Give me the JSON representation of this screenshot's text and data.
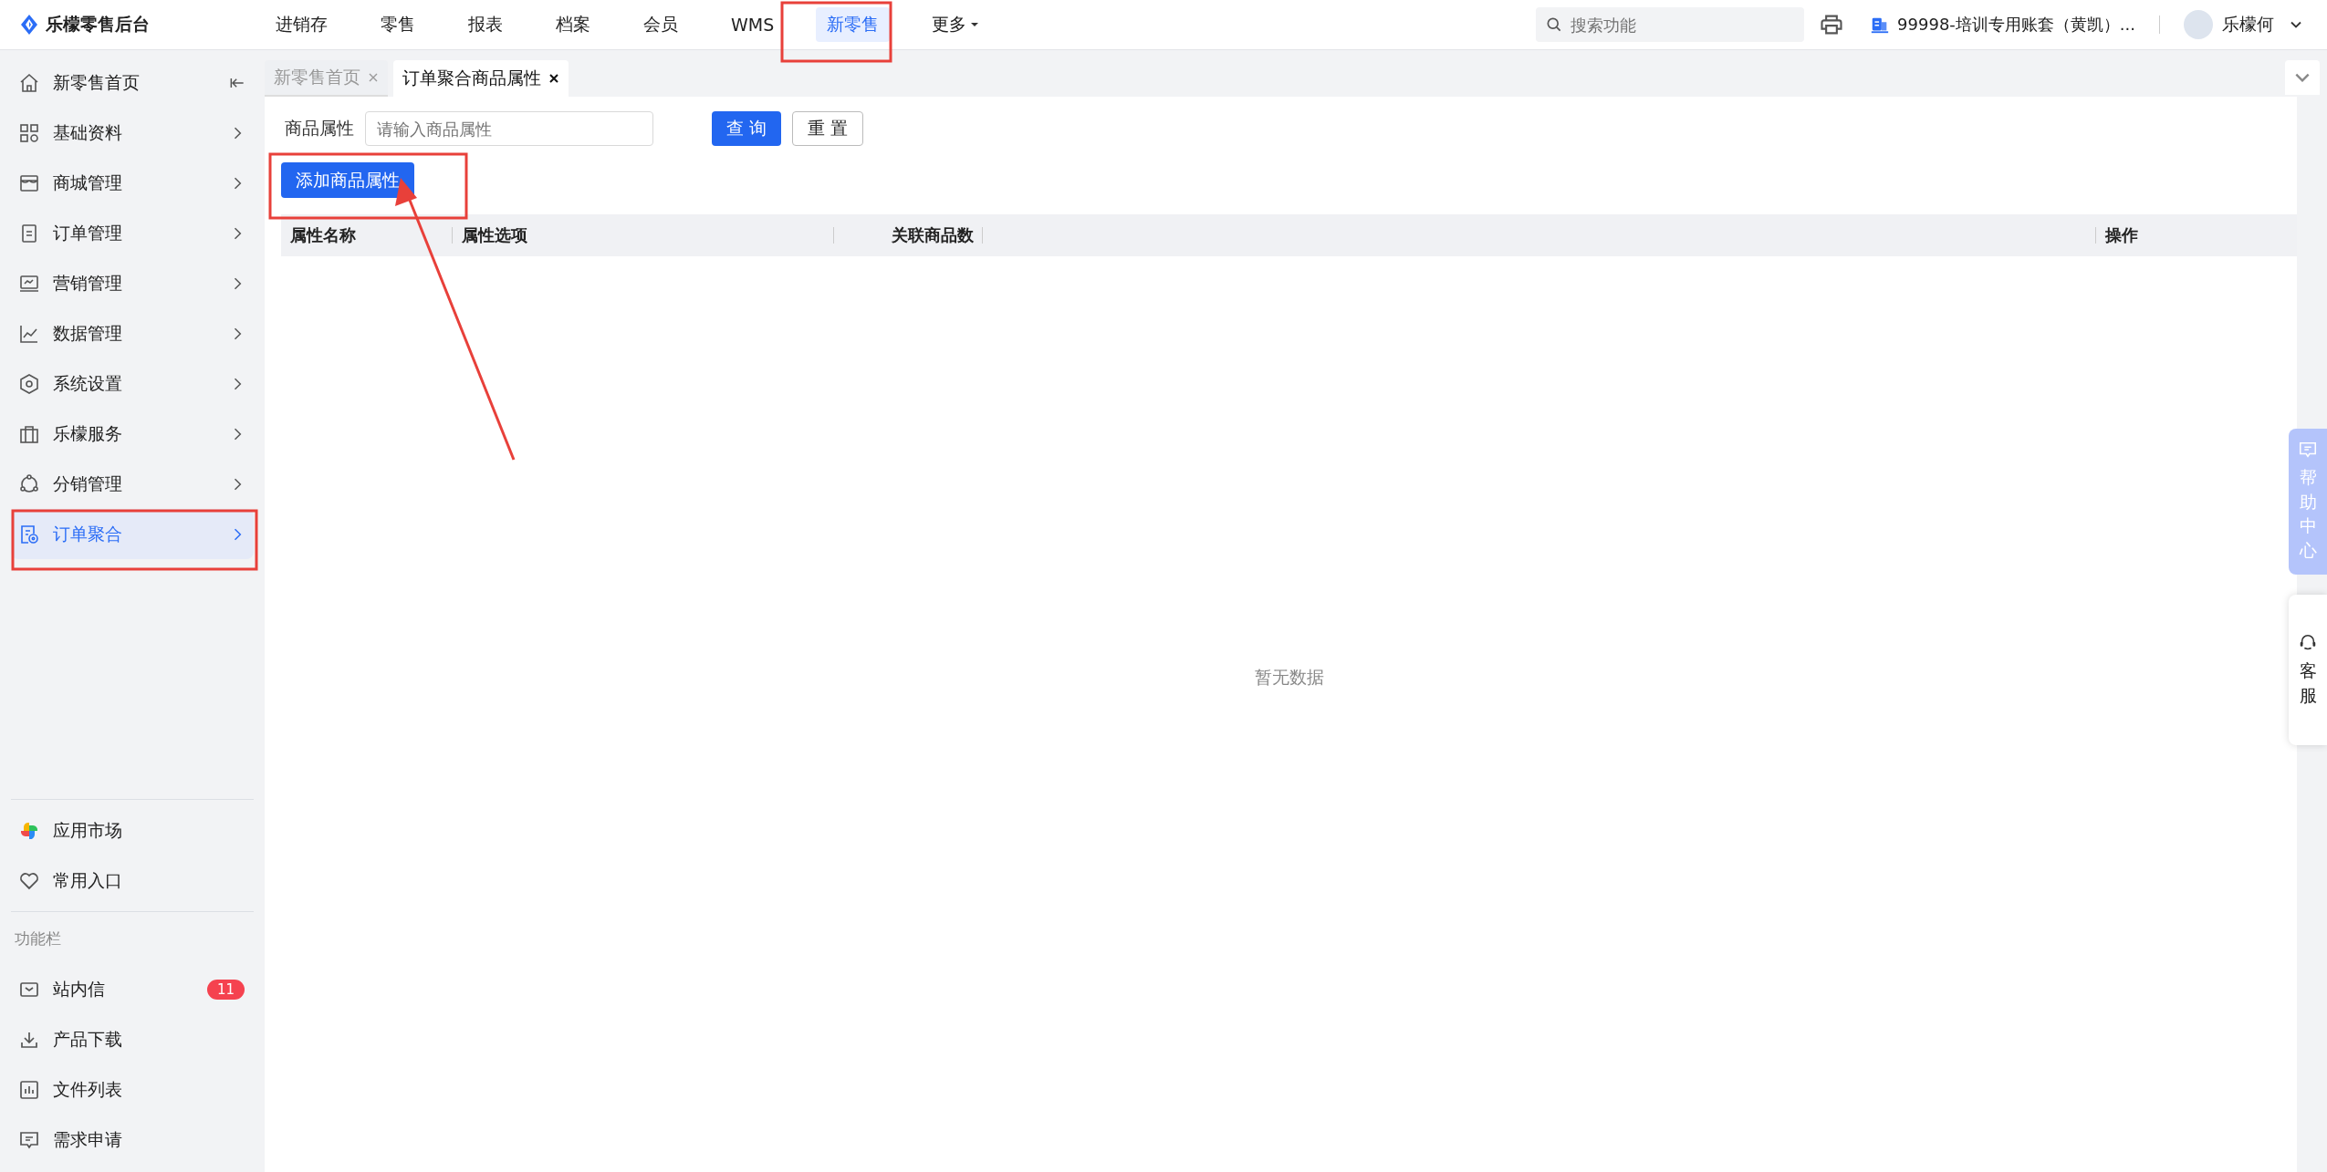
{
  "brand": {
    "title": "乐檬零售后台"
  },
  "top_nav": [
    {
      "label": "进销存",
      "selected": false,
      "dropdown": false
    },
    {
      "label": "零售",
      "selected": false,
      "dropdown": false
    },
    {
      "label": "报表",
      "selected": false,
      "dropdown": false
    },
    {
      "label": "档案",
      "selected": false,
      "dropdown": false
    },
    {
      "label": "会员",
      "selected": false,
      "dropdown": false
    },
    {
      "label": "WMS",
      "selected": false,
      "dropdown": false
    },
    {
      "label": "新零售",
      "selected": true,
      "dropdown": false
    },
    {
      "label": "更多",
      "selected": false,
      "dropdown": true
    }
  ],
  "search": {
    "placeholder": "搜索功能"
  },
  "account": {
    "name": "99998-培训专用账套（黄凯）..."
  },
  "user": {
    "name": "乐檬何"
  },
  "sidebar": {
    "home": {
      "label": "新零售首页"
    },
    "items": [
      {
        "label": "基础资料",
        "selected": false
      },
      {
        "label": "商城管理",
        "selected": false
      },
      {
        "label": "订单管理",
        "selected": false
      },
      {
        "label": "营销管理",
        "selected": false
      },
      {
        "label": "数据管理",
        "selected": false
      },
      {
        "label": "系统设置",
        "selected": false
      },
      {
        "label": "乐檬服务",
        "selected": false
      },
      {
        "label": "分销管理",
        "selected": false
      },
      {
        "label": "订单聚合",
        "selected": true
      }
    ],
    "apps": [
      {
        "label": "应用市场"
      },
      {
        "label": "常用入口"
      }
    ],
    "section_label": "功能栏",
    "functions": [
      {
        "label": "站内信",
        "badge": "11"
      },
      {
        "label": "产品下载"
      },
      {
        "label": "文件列表"
      },
      {
        "label": "需求申请"
      }
    ]
  },
  "tabs": [
    {
      "label": "新零售首页",
      "selected": false
    },
    {
      "label": "订单聚合商品属性",
      "selected": true
    }
  ],
  "filter": {
    "label": "商品属性",
    "placeholder": "请输入商品属性",
    "buttons": [
      {
        "label": "查 询",
        "kind": "primary"
      },
      {
        "label": "重 置",
        "kind": "default"
      }
    ]
  },
  "add_button": "添加商品属性",
  "table": {
    "columns": [
      {
        "label": "属性名称"
      },
      {
        "label": "属性选项"
      },
      {
        "label": "关联商品数"
      },
      {},
      {
        "label": "操作"
      }
    ],
    "empty_text": "暂无数据"
  },
  "float_tabs": [
    {
      "label": "帮助中心",
      "kind": "help"
    },
    {
      "label": "客服",
      "kind": "service"
    }
  ]
}
